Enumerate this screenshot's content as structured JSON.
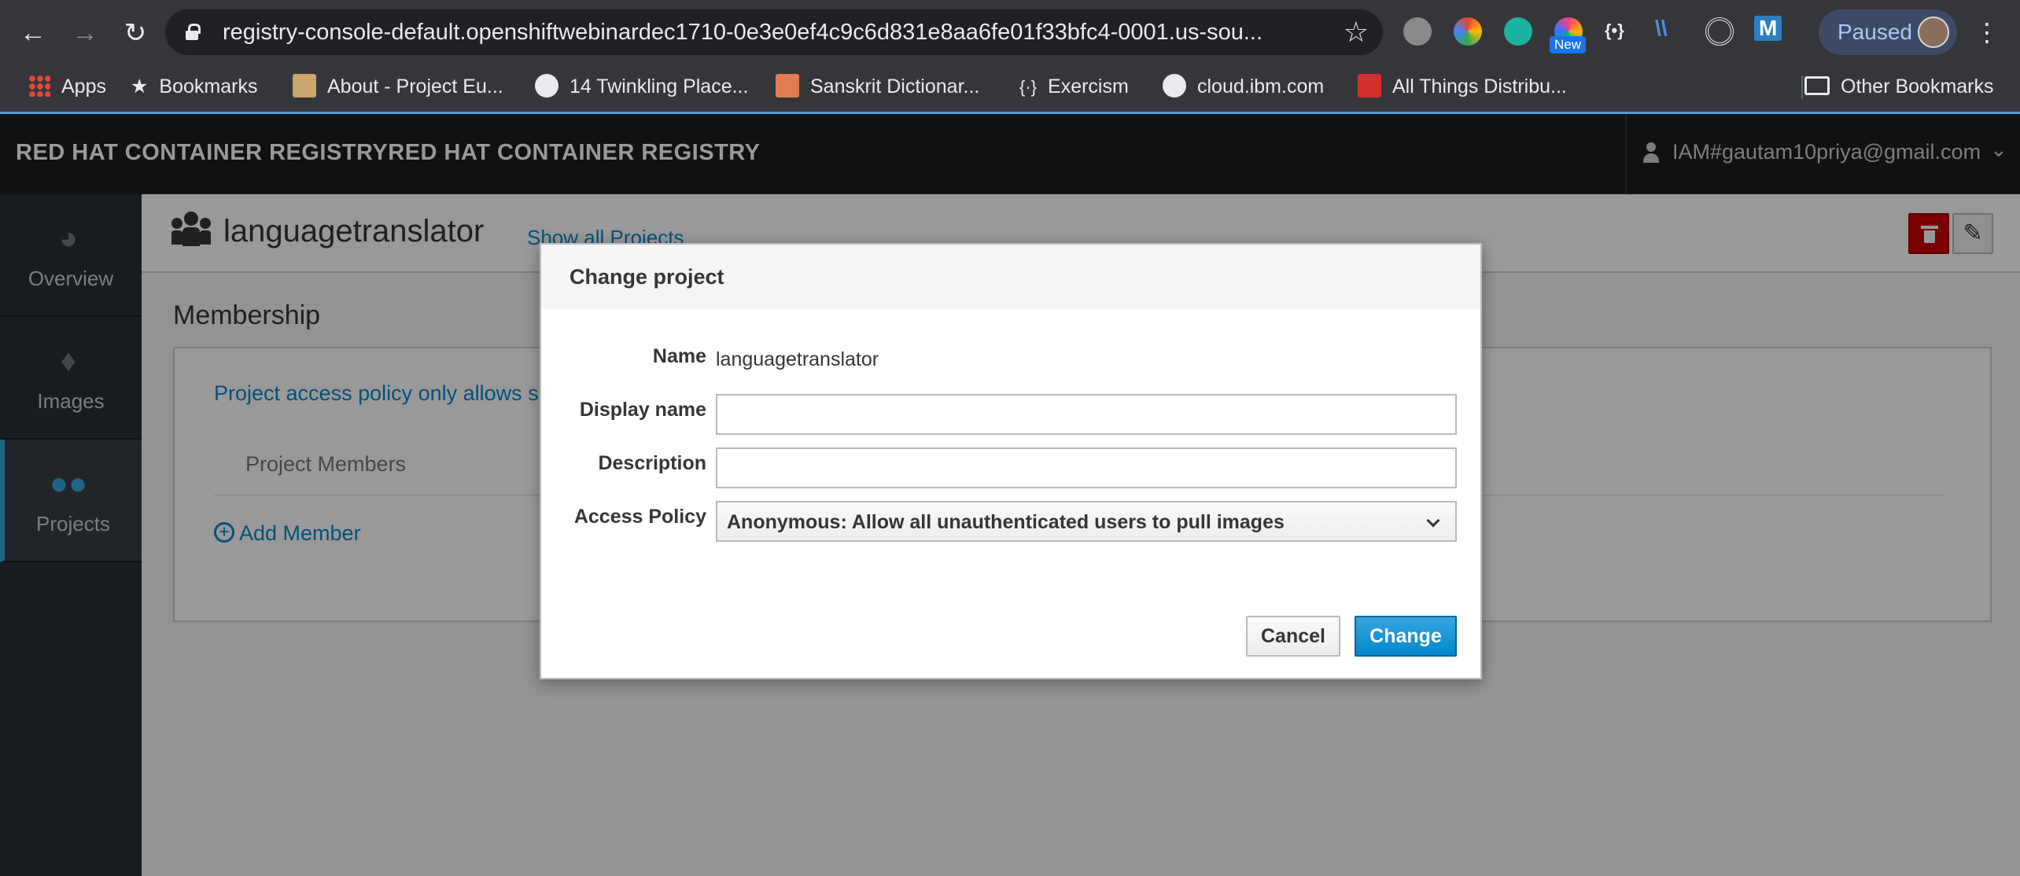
{
  "browser": {
    "url": "registry-console-default.openshiftwebinardec1710-0e3e0ef4c9c6d831e8aa6fe01f33bfc4-0001.us-sou...",
    "new_badge": "New",
    "profile_status": "Paused",
    "bookmarks": [
      {
        "label": "Apps",
        "icon": "apps-grid-icon"
      },
      {
        "label": "Bookmarks",
        "icon": "star-icon"
      },
      {
        "label": "About - Project Eu...",
        "icon": "project-euler-icon"
      },
      {
        "label": "14 Twinkling Place...",
        "icon": "globe-icon"
      },
      {
        "label": "Sanskrit Dictionar...",
        "icon": "sanskrit-dictionary-icon"
      },
      {
        "label": "Exercism",
        "icon": "exercism-icon"
      },
      {
        "label": "cloud.ibm.com",
        "icon": "globe-icon"
      },
      {
        "label": "All Things Distribu...",
        "icon": "all-things-distributed-icon"
      }
    ],
    "other_bookmarks": "Other Bookmarks"
  },
  "app": {
    "brand": "RED HAT CONTAINER REGISTRYRED HAT CONTAINER REGISTRY",
    "user_email": "IAM#gautam10priya@gmail.com"
  },
  "sidebar": {
    "items": [
      {
        "label": "Overview",
        "icon": "dashboard-icon",
        "active": false
      },
      {
        "label": "Images",
        "icon": "layers-icon",
        "active": false
      },
      {
        "label": "Projects",
        "icon": "users-icon",
        "active": true
      }
    ]
  },
  "project": {
    "name": "languagetranslator",
    "show_all": "Show all Projects",
    "section_title": "Membership",
    "policy_note": "Project access policy only allows sp",
    "members_label": "Project Members",
    "add_member": "Add Member"
  },
  "modal": {
    "title": "Change project",
    "name_label": "Name",
    "name_value": "languagetranslator",
    "display_name_label": "Display name",
    "display_name_value": "",
    "description_label": "Description",
    "description_value": "",
    "access_policy_label": "Access Policy",
    "access_policy_value": "Anonymous: Allow all unauthenticated users to pull images",
    "cancel_label": "Cancel",
    "change_label": "Change"
  },
  "colors": {
    "accent": "#0088ce",
    "danger": "#cc0000",
    "header_bg": "#1d1d1d",
    "sidebar_bg": "#292e34",
    "active_indicator": "#39a5dc"
  }
}
